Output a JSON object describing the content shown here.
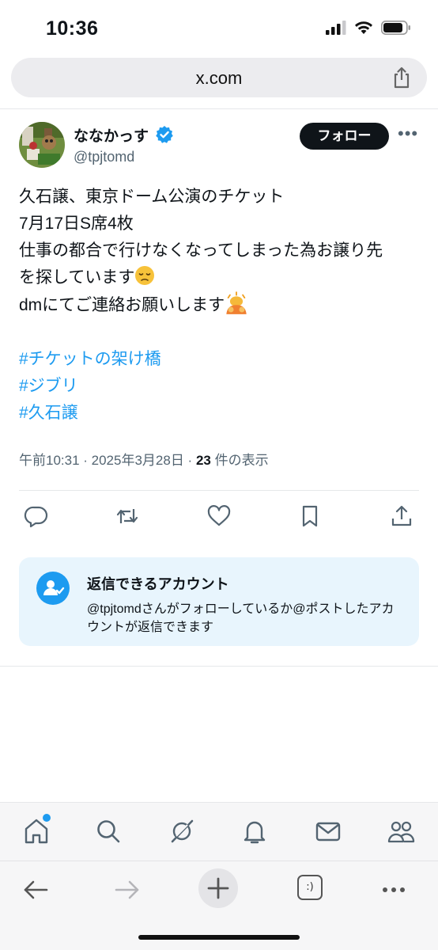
{
  "status_bar": {
    "time": "10:36",
    "icons": [
      "cellular-signal-icon",
      "wifi-icon",
      "battery-icon"
    ]
  },
  "browser": {
    "url": "x.com",
    "share_icon": "share-icon",
    "toolbar": {
      "back_icon": "back-arrow-icon",
      "forward_icon": "forward-arrow-icon",
      "new_tab_icon": "plus-icon",
      "tabs_label": ":)",
      "more_icon": "more-dots-icon"
    }
  },
  "post": {
    "author": {
      "display_name": "ななかっす",
      "handle": "@tpjtomd",
      "verified": true
    },
    "follow_label": "フォロー",
    "more_label": "•••",
    "lines": [
      "久石譲、東京ドーム公演のチケット",
      "7月17日S席4枚",
      "仕事の都合で行けなくなってしまった為お譲り先",
      "を探しています",
      "dmにてご連絡お願いします"
    ],
    "hashtags": [
      "#チケットの架け橋",
      "#ジブリ",
      "#久石譲"
    ],
    "meta": {
      "timestamp": "午前10:31 · 2025年3月28日 · ",
      "views_count": "23",
      "views_label": " 件の表示"
    },
    "actions": [
      "reply-icon",
      "repost-icon",
      "like-icon",
      "bookmark-icon",
      "share-icon"
    ]
  },
  "reply_restriction": {
    "title": "返信できるアカウント",
    "description": "@tpjtomdさんがフォローしているか@ポストしたアカウントが返信できます"
  },
  "tab_bar": {
    "tabs": [
      "home-icon",
      "search-icon",
      "grok-icon",
      "notifications-icon",
      "messages-icon",
      "communities-icon"
    ],
    "home_has_notification_dot": true
  },
  "colors": {
    "accent": "#1d9bf0",
    "text": "#0f1419",
    "secondary_text": "#536471",
    "reply_box_bg": "#e8f5fd"
  }
}
